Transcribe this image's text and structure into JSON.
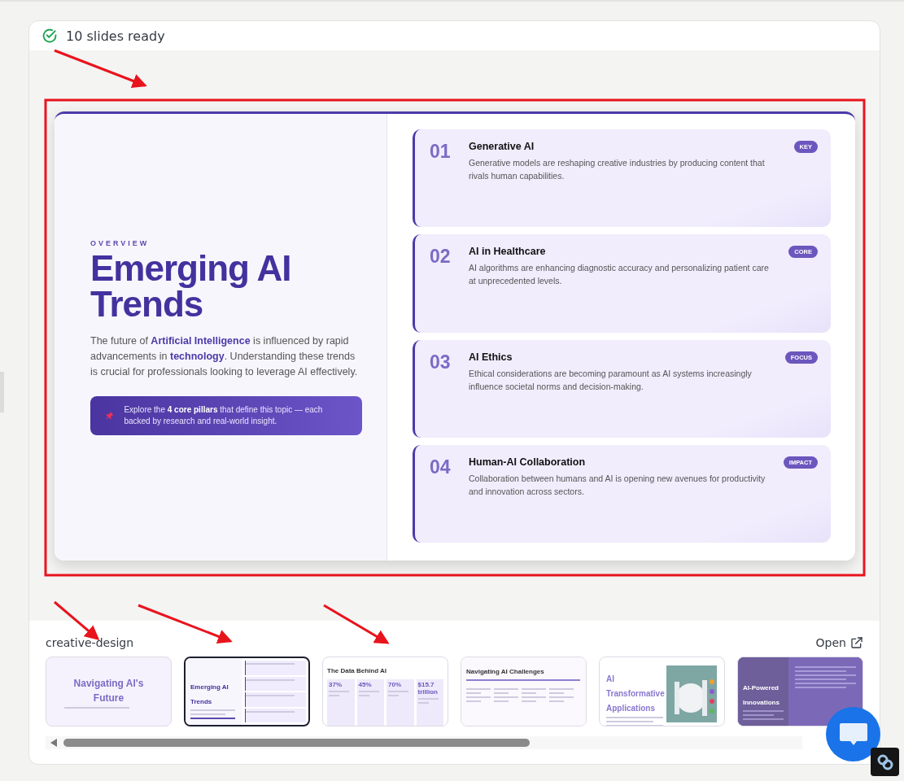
{
  "header": {
    "status": "10 slides ready"
  },
  "slide": {
    "eyebrow": "OVERVIEW",
    "title": "Emerging AI Trends",
    "intro": "The future of **Artificial Intelligence** is influenced by rapid advancements in **technology**. Understanding these trends is crucial for professionals looking to leverage AI effectively.",
    "callout": "Explore the **4 core pillars** that define this topic — each backed by research and real-world insight.",
    "pillars": [
      {
        "number": "01",
        "title": "Generative AI",
        "text": "Generative models are reshaping creative industries by producing content that rivals human capabilities.",
        "tag": "KEY"
      },
      {
        "number": "02",
        "title": "AI in Healthcare",
        "text": "AI algorithms are enhancing diagnostic accuracy and personalizing patient care at unprecedented levels.",
        "tag": "CORE"
      },
      {
        "number": "03",
        "title": "AI Ethics",
        "text": "Ethical considerations are becoming paramount as AI systems increasingly influence societal norms and decision-making.",
        "tag": "FOCUS"
      },
      {
        "number": "04",
        "title": "Human-AI Collaboration",
        "text": "Collaboration between humans and AI is opening new avenues for productivity and innovation across sectors.",
        "tag": "IMPACT"
      }
    ]
  },
  "gallery": {
    "name": "creative-design",
    "open": "Open",
    "thumbnails": [
      {
        "kind": "title",
        "selected": false,
        "title": "Navigating AI's Future"
      },
      {
        "kind": "split",
        "selected": true,
        "title": "Emerging AI Trends"
      },
      {
        "kind": "stats",
        "selected": false,
        "title": "The Data Behind AI",
        "stats": [
          "37%",
          "45%",
          "70%",
          "$15.7 trillion"
        ]
      },
      {
        "kind": "timeline",
        "selected": false,
        "title": "Navigating AI Challenges"
      },
      {
        "selected": false,
        "title": "AI Transformative Applications"
      },
      {
        "kind": "dark",
        "selected": false,
        "title": "AI-Powered Innovations"
      }
    ]
  }
}
